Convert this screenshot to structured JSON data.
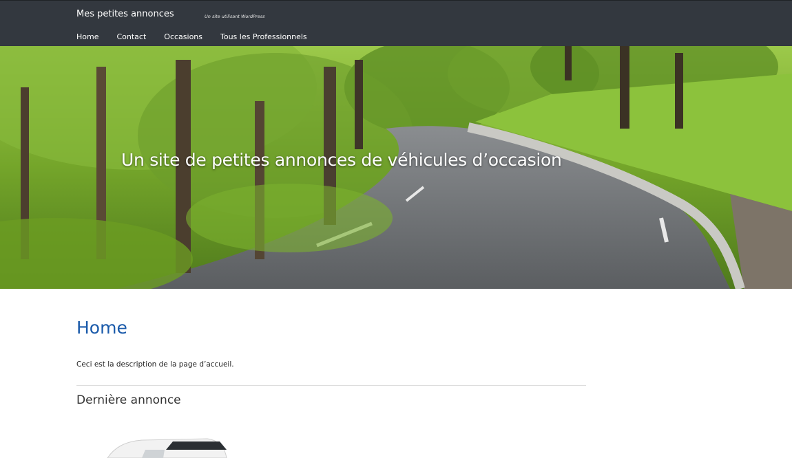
{
  "header": {
    "site_title": "Mes petites annonces",
    "tagline": "Un site utilisant WordPress",
    "background_color": "#33383f"
  },
  "nav": {
    "items": [
      {
        "label": "Home"
      },
      {
        "label": "Contact"
      },
      {
        "label": "Occasions"
      },
      {
        "label": "Tous les Professionnels"
      }
    ]
  },
  "hero": {
    "headline": "Un site de petites annonces de véhicules d’occasion"
  },
  "main": {
    "page_title": "Home",
    "description": "Ceci est la description de la page d’accueil.",
    "section_title": "Dernière annonce"
  },
  "colors": {
    "accent": "#1a5aaa",
    "text": "#222222"
  }
}
